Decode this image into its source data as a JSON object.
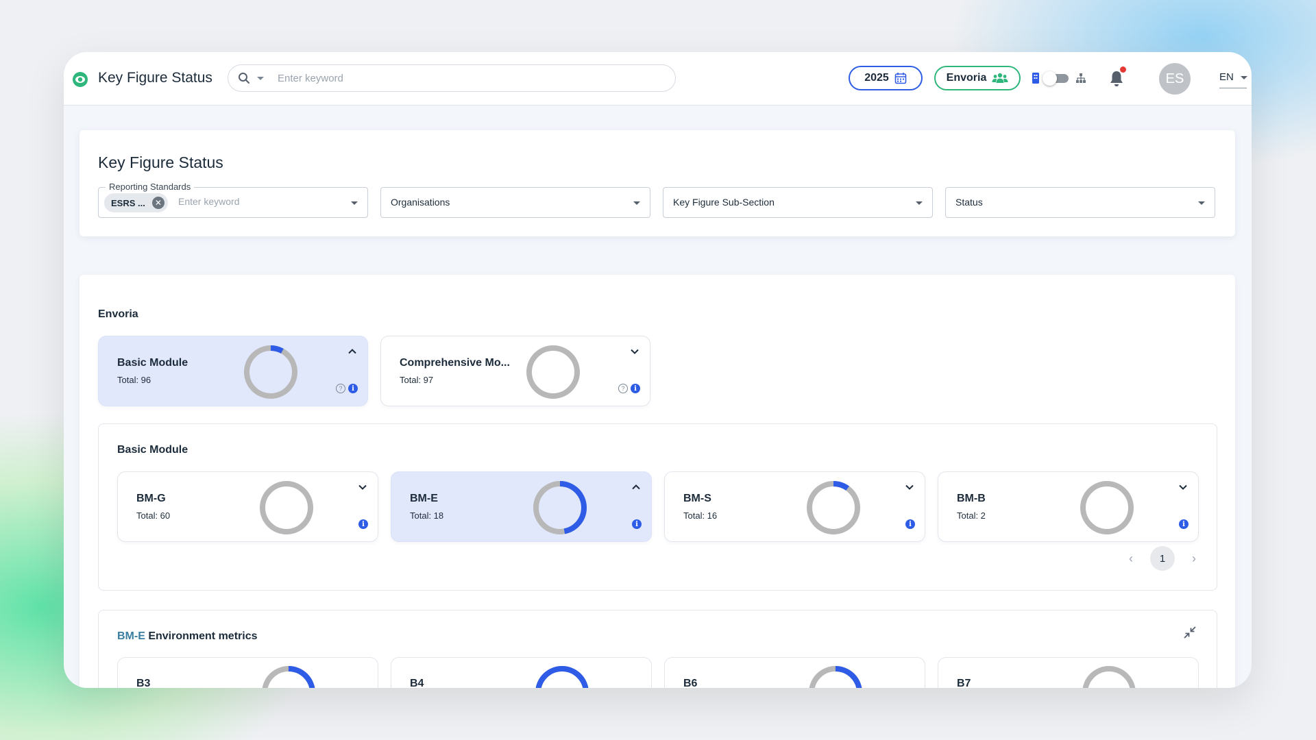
{
  "header": {
    "app_title": "Key Figure Status",
    "search_placeholder": "Enter keyword",
    "year": "2025",
    "organisation": "Envoria",
    "avatar_initials": "ES",
    "language": "EN"
  },
  "filters": {
    "page_title": "Key Figure Status",
    "reporting_standards_label": "Reporting Standards",
    "reporting_standards_chip": "ESRS ...",
    "reporting_standards_placeholder": "Enter keyword",
    "organisations_label": "Organisations",
    "subsection_label": "Key Figure Sub-Section",
    "status_label": "Status"
  },
  "main": {
    "org_name": "Envoria",
    "modules": [
      {
        "name": "Basic Module",
        "total": "Total: 96",
        "progress": 0.08,
        "selected": true
      },
      {
        "name": "Comprehensive Mo...",
        "total": "Total: 97",
        "progress": 0.0,
        "selected": false
      }
    ],
    "sub_panel": {
      "title": "Basic Module",
      "sections": [
        {
          "name": "BM-G",
          "total": "Total: 60",
          "progress": 0.0,
          "selected": false
        },
        {
          "name": "BM-E",
          "total": "Total: 18",
          "progress": 0.47,
          "selected": true
        },
        {
          "name": "BM-S",
          "total": "Total: 16",
          "progress": 0.1,
          "selected": false
        },
        {
          "name": "BM-B",
          "total": "Total: 2",
          "progress": 0.0,
          "selected": false
        }
      ],
      "page": "1"
    },
    "metrics_panel": {
      "code": "BM-E",
      "title": " Environment metrics",
      "cards": [
        {
          "name": "B3",
          "progress": 0.28
        },
        {
          "name": "B4",
          "progress": 1.0
        },
        {
          "name": "B6",
          "progress": 0.33
        },
        {
          "name": "B7",
          "progress": 0.0
        }
      ]
    }
  },
  "colors": {
    "accent_blue": "#2e5ce6",
    "accent_green": "#2fb67c",
    "donut_track": "#b8b8b8",
    "selected_bg": "#e2e8fb",
    "notification": "#e53935"
  }
}
